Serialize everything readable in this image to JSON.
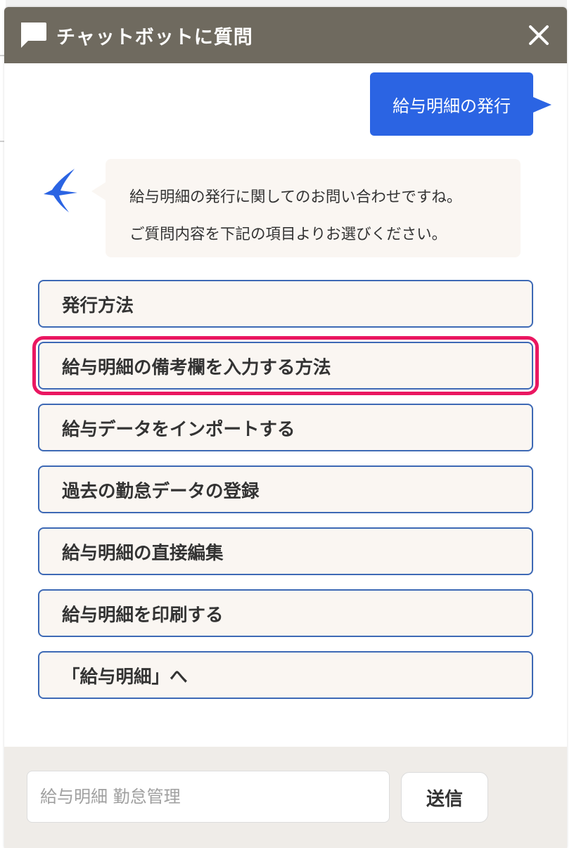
{
  "header": {
    "title": "チャットボットに質問",
    "close_label": "×"
  },
  "conversation": {
    "user_message": "給与明細の発行",
    "bot_message_line1": "給与明細の発行に関してのお問い合わせですね。",
    "bot_message_line2": "ご質問内容を下記の項目よりお選びください。"
  },
  "options": [
    {
      "label": "発行方法",
      "highlighted": false
    },
    {
      "label": "給与明細の備考欄を入力する方法",
      "highlighted": true
    },
    {
      "label": "給与データをインポートする",
      "highlighted": false
    },
    {
      "label": "過去の勤怠データの登録",
      "highlighted": false
    },
    {
      "label": "給与明細の直接編集",
      "highlighted": false
    },
    {
      "label": "給与明細を印刷する",
      "highlighted": false
    },
    {
      "label": "「給与明細」へ",
      "highlighted": false
    }
  ],
  "footer": {
    "input_placeholder": "給与明細 勤怠管理",
    "input_value": "",
    "send_label": "送信"
  },
  "colors": {
    "header_bg": "#6f6a5f",
    "user_bubble": "#2b64e3",
    "option_border": "#3d69b5",
    "highlight": "#ea1761",
    "bubble_bg": "#faf6f2"
  },
  "icons": {
    "header": "chat-bubble-icon",
    "close": "close-icon",
    "bot_avatar": "swallow-bird-icon"
  }
}
